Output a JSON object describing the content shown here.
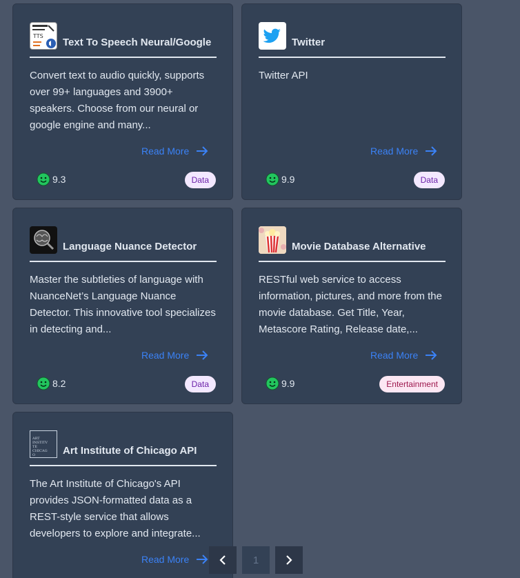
{
  "cards": [
    {
      "title": "Text To Speech Neural/Google",
      "description": "Convert text to audio quickly, supports over 99+ languages and 3900+ speakers. Choose from our neural or google engine and many...",
      "read_more": "Read More",
      "rating": "9.3",
      "tag": "Data",
      "logo_icon": "tts-logo-icon"
    },
    {
      "title": "Twitter",
      "description": "Twitter API",
      "read_more": "Read More",
      "rating": "9.9",
      "tag": "Data",
      "logo_icon": "twitter-bird-icon"
    },
    {
      "title": "Language Nuance Detector",
      "description": "Master the subtleties of language with NuanceNet’s Language Nuance Detector. This innovative tool specializes in detecting and...",
      "read_more": "Read More",
      "rating": "8.2",
      "tag": "Data",
      "logo_icon": "brain-magnifier-logo-icon"
    },
    {
      "title": "Movie Database Alternative",
      "description": "RESTful web service to access information, pictures, and more from the movie database. Get Title, Year, Metascore Rating, Release date,...",
      "read_more": "Read More",
      "rating": "9.9",
      "tag": "Entertainment",
      "logo_icon": "popcorn-logo-icon"
    },
    {
      "title": "Art Institute of Chicago API",
      "description": "The Art Institute of Chicago's API provides JSON-formatted data as a REST-style service that allows developers to explore and integrate...",
      "read_more": "Read More",
      "rating": "",
      "tag": "",
      "logo_icon": "art-institute-logo-icon",
      "logo_text": "ART INSTITVTE CHICAGO"
    }
  ],
  "pagination": {
    "prev": "‹",
    "current": "1",
    "next": "›"
  },
  "colors": {
    "background": "#4a5568",
    "card": "#334155",
    "link": "#3b82f6",
    "highlight": "#ffff00"
  }
}
